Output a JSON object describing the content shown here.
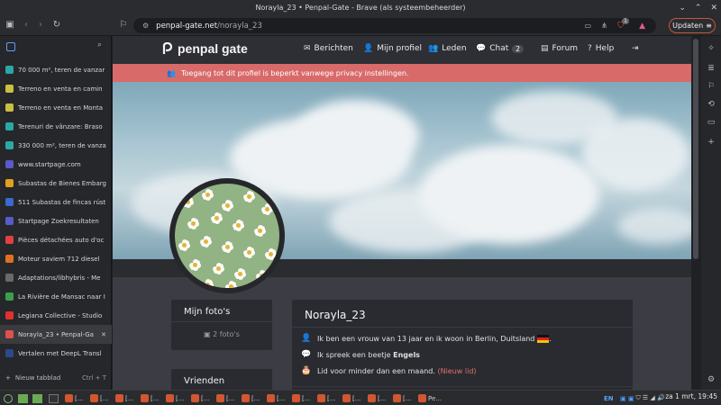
{
  "window": {
    "title": "Norayla_23 • Penpal-Gate - Brave (als systeembeheerder)"
  },
  "toolbar": {
    "url_host": "penpal-gate.net",
    "url_path": "/norayla_23",
    "update_label": "Updaten",
    "brave_badge": "1"
  },
  "tabs": [
    {
      "label": "70 000 m², teren de vanzar",
      "fav_color": "#2aa8a8"
    },
    {
      "label": "Terreno en venta en camin",
      "fav_color": "#c8c240"
    },
    {
      "label": "Terreno en venta en Monta",
      "fav_color": "#c8c240"
    },
    {
      "label": "Terenuri de vânzare: Braso",
      "fav_color": "#2aa8a8"
    },
    {
      "label": "330 000 m², teren de vanza",
      "fav_color": "#2aa8a8"
    },
    {
      "label": "www.startpage.com",
      "fav_color": "#5a5ac8"
    },
    {
      "label": "Subastas de Bienes Embarg",
      "fav_color": "#e0a020"
    },
    {
      "label": "511 Subastas de fincas rúst",
      "fav_color": "#3a6ad0"
    },
    {
      "label": "Startpage Zoekresultaten",
      "fav_color": "#5a5ac8"
    },
    {
      "label": "Pièces détachées auto d'oc",
      "fav_color": "#e04040"
    },
    {
      "label": "Moteur saviem 712 diesel",
      "fav_color": "#e07020"
    },
    {
      "label": "Adaptations/libhybris - Me",
      "fav_color": "#6a6a6a"
    },
    {
      "label": "La Rivière de Mansac naar I",
      "fav_color": "#3aa04a"
    },
    {
      "label": "Legiana Collective - Studio",
      "fav_color": "#e03030"
    },
    {
      "label": "Norayla_23 • Penpal-Ga",
      "fav_color": "#e05050"
    },
    {
      "label": "Vertalen met DeepL Transl",
      "fav_color": "#2a4a8a"
    }
  ],
  "new_tab": {
    "label": "Nieuw tabblad",
    "shortcut": "Ctrl + T"
  },
  "site": {
    "logo": "penpal gate",
    "nav": {
      "berichten": "Berichten",
      "profiel": "Mijn profiel",
      "leden": "Leden",
      "chat": "Chat",
      "chat_count": "2",
      "forum": "Forum",
      "help": "Help"
    },
    "alert": "Toegang tot dit profiel is beperkt vanwege privacy instellingen."
  },
  "profile": {
    "photos_title": "Mijn foto's",
    "photos_count": "2 foto's",
    "friends_title": "Vrienden",
    "username": "Norayla_23",
    "about": "Ik ben een vrouw van 13 jaar en ik woon in Berlin, Duitsland",
    "language_prefix": "Ik spreek een beetje",
    "language": "Engels",
    "member_since": "Lid voor minder dan een maand.",
    "new_badge": "(Nieuw lid)"
  },
  "taskbar": {
    "lang": "EN",
    "clock": "za  1 mrt, 19:45",
    "items": [
      "[...",
      "[...",
      "[...",
      "[...",
      "[...",
      "[...",
      "[...",
      "[...",
      "[...",
      "[...",
      "[...",
      "[...",
      "[...",
      "[...",
      "Pe..."
    ]
  }
}
